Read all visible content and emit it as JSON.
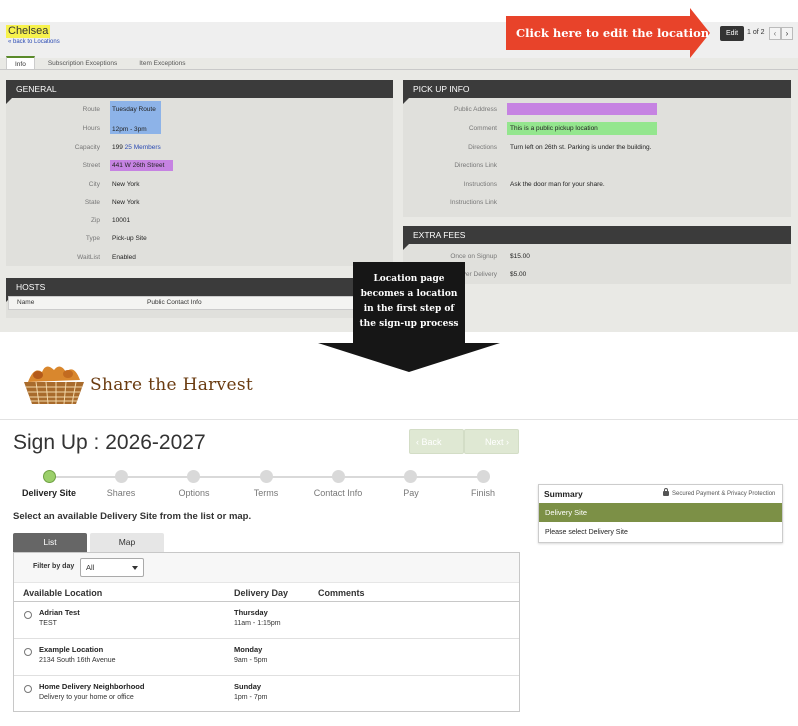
{
  "admin": {
    "location_title": "Chelsea",
    "back_link": "« back to Locations",
    "edit_label": "Edit",
    "pager": "1 of 2",
    "pager_prev": "‹",
    "pager_next": "›",
    "callout": "Click here to edit the location",
    "tabs": [
      "Info",
      "Subscription Exceptions",
      "Item Exceptions"
    ],
    "general": {
      "title": "GENERAL",
      "rows": [
        {
          "label": "Route",
          "value": "Tuesday Route"
        },
        {
          "label": "Hours",
          "value": "12pm - 3pm"
        },
        {
          "label": "Capacity",
          "value": "199",
          "link": "25 Members"
        },
        {
          "label": "Street",
          "value": "441 W 26th Street"
        },
        {
          "label": "City",
          "value": "New York"
        },
        {
          "label": "State",
          "value": "New York"
        },
        {
          "label": "Zip",
          "value": "10001"
        },
        {
          "label": "Type",
          "value": "Pick-up Site"
        },
        {
          "label": "WaitList",
          "value": "Enabled"
        }
      ]
    },
    "pickup": {
      "title": "PICK UP INFO",
      "rows": [
        {
          "label": "Public Address",
          "value": ""
        },
        {
          "label": "Comment",
          "value": "This is a public pickup location"
        },
        {
          "label": "Directions",
          "value": "Turn left on 26th st. Parking is under the building."
        },
        {
          "label": "Directions Link",
          "value": ""
        },
        {
          "label": "Instructions",
          "value": "Ask the door man for your share."
        },
        {
          "label": "Instructions Link",
          "value": ""
        }
      ]
    },
    "fees": {
      "title": "EXTRA FEES",
      "rows": [
        {
          "label": "Once on Signup",
          "value": "$15.00"
        },
        {
          "label": "Per Delivery",
          "value": "$5.00"
        }
      ]
    },
    "hosts": {
      "title": "HOSTS",
      "columns": [
        "Name",
        "Public Contact Info"
      ]
    },
    "arrow_note": "Location page becomes a location in the first step of the sign-up process"
  },
  "signup": {
    "brand": "Share the Harvest",
    "title": "Sign Up : 2026-2027",
    "back_label": "Back",
    "next_label": "Next",
    "steps": [
      "Delivery Site",
      "Shares",
      "Options",
      "Terms",
      "Contact Info",
      "Pay",
      "Finish"
    ],
    "active_step": 0,
    "instruction": "Select an available Delivery Site from the list or map.",
    "view_tabs": [
      "List",
      "Map"
    ],
    "filter_label": "Filter by day",
    "filter_value": "All",
    "columns": [
      "Available Location",
      "Delivery Day",
      "Comments"
    ],
    "locations": [
      {
        "name": "Adrian Test",
        "sub": "TEST",
        "day": "Thursday",
        "time": "11am - 1:15pm"
      },
      {
        "name": "Example Location",
        "sub": "2134 South 16th Avenue",
        "day": "Monday",
        "time": "9am - 5pm"
      },
      {
        "name": "Home Delivery Neighborhood",
        "sub": "Delivery to your home or office",
        "day": "Sunday",
        "time": "1pm - 7pm"
      }
    ],
    "summary": {
      "title": "Summary",
      "secure": "Secured Payment & Privacy Protection",
      "active_item": "Delivery Site",
      "message": "Please select Delivery Site"
    }
  },
  "colors": {
    "callout_red": "#e8432a",
    "summary_green": "#7c9046",
    "step_active": "#9bcf6a",
    "brand_brown": "#6a3b10"
  }
}
